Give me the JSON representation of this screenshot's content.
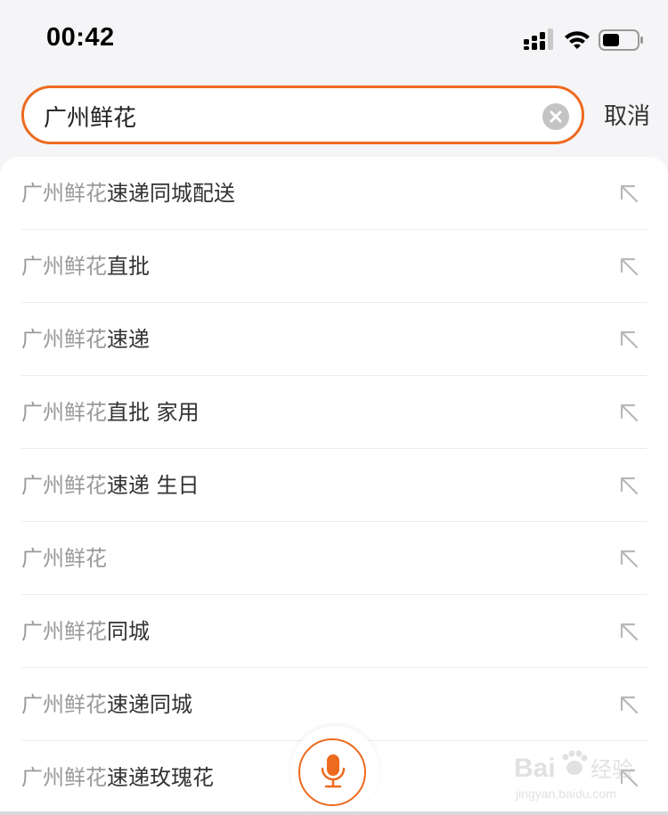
{
  "status_bar": {
    "time": "00:42"
  },
  "search": {
    "value": "广州鲜花",
    "cancel_label": "取消",
    "accent_color": "#ee6a1f"
  },
  "suggestions": [
    {
      "match": "广州鲜花",
      "rest": "速递同城配送"
    },
    {
      "match": "广州鲜花",
      "rest": "直批"
    },
    {
      "match": "广州鲜花",
      "rest": "速递"
    },
    {
      "match": "广州鲜花",
      "rest": "直批 家用"
    },
    {
      "match": "广州鲜花",
      "rest": "速递 生日"
    },
    {
      "match": "广州鲜花",
      "rest": ""
    },
    {
      "match": "广州鲜花",
      "rest": "同城"
    },
    {
      "match": "广州鲜花",
      "rest": "速递同城"
    },
    {
      "match": "广州鲜花",
      "rest": "速递玫瑰花"
    }
  ],
  "icons": {
    "suggestion_fill": "arrow-up-left-icon",
    "voice": "microphone-icon",
    "clear": "clear-circle-icon"
  },
  "watermark": {
    "brand": "Bai",
    "brand2": "经验",
    "url": "jingyan.baidu.com"
  }
}
